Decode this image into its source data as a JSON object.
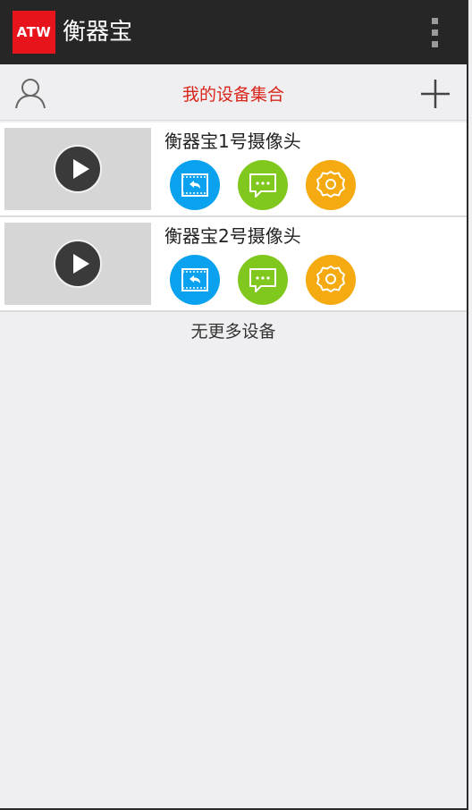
{
  "app": {
    "logo_text": "ATW",
    "title": "衡器宝",
    "menu_icon": "overflow-menu-icon"
  },
  "header": {
    "title": "我的设备集合",
    "left_icon": "user-icon",
    "right_icon": "add-icon"
  },
  "devices": [
    {
      "name": "衡器宝1号摄像头"
    },
    {
      "name": "衡器宝2号摄像头"
    }
  ],
  "footer": {
    "note": "无更多设备"
  },
  "colors": {
    "actionbar": "#262626",
    "logo": "#e8141c",
    "header_title": "#d9251a",
    "playback_button": "#0aa2ee",
    "message_button": "#80c81e",
    "settings_button": "#f4aa10"
  }
}
